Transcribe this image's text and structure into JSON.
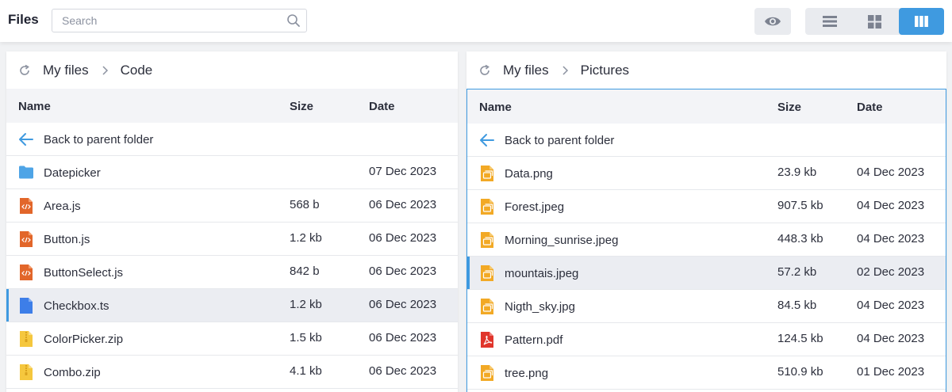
{
  "app": {
    "title": "Files"
  },
  "search": {
    "placeholder": "Search",
    "value": ""
  },
  "toolbar": {
    "preview_icon": "eye-icon",
    "views": [
      "list-view-icon",
      "grid-view-icon",
      "columns-view-icon"
    ],
    "active_view": "columns",
    "accent": "#3f9ae0"
  },
  "left": {
    "breadcrumb": [
      "My files",
      "Code"
    ],
    "columns": {
      "name": "Name",
      "size": "Size",
      "date": "Date"
    },
    "back": "Back to parent folder",
    "rows": [
      {
        "name": "Datepicker",
        "size": "",
        "date": "07 Dec 2023",
        "type": "folder"
      },
      {
        "name": "Area.js",
        "size": "568 b",
        "date": "06 Dec 2023",
        "type": "code"
      },
      {
        "name": "Button.js",
        "size": "1.2 kb",
        "date": "06 Dec 2023",
        "type": "code"
      },
      {
        "name": "ButtonSelect.js",
        "size": "842 b",
        "date": "06 Dec 2023",
        "type": "code"
      },
      {
        "name": "Checkbox.ts",
        "size": "1.2 kb",
        "date": "06 Dec 2023",
        "type": "ts",
        "selected": true
      },
      {
        "name": "ColorPicker.zip",
        "size": "1.5 kb",
        "date": "06 Dec 2023",
        "type": "zip"
      },
      {
        "name": "Combo.zip",
        "size": "4.1 kb",
        "date": "06 Dec 2023",
        "type": "zip"
      }
    ]
  },
  "right": {
    "breadcrumb": [
      "My files",
      "Pictures"
    ],
    "columns": {
      "name": "Name",
      "size": "Size",
      "date": "Date"
    },
    "back": "Back to parent folder",
    "rows": [
      {
        "name": "Data.png",
        "size": "23.9 kb",
        "date": "04 Dec 2023",
        "type": "image"
      },
      {
        "name": "Forest.jpeg",
        "size": "907.5 kb",
        "date": "04 Dec 2023",
        "type": "image"
      },
      {
        "name": "Morning_sunrise.jpeg",
        "size": "448.3 kb",
        "date": "04 Dec 2023",
        "type": "image"
      },
      {
        "name": "mountais.jpeg",
        "size": "57.2 kb",
        "date": "02 Dec 2023",
        "type": "image",
        "selected": true
      },
      {
        "name": "Nigth_sky.jpg",
        "size": "84.5 kb",
        "date": "04 Dec 2023",
        "type": "image"
      },
      {
        "name": "Pattern.pdf",
        "size": "124.5 kb",
        "date": "04 Dec 2023",
        "type": "pdf"
      },
      {
        "name": "tree.png",
        "size": "510.9 kb",
        "date": "01 Dec 2023",
        "type": "image"
      }
    ]
  }
}
